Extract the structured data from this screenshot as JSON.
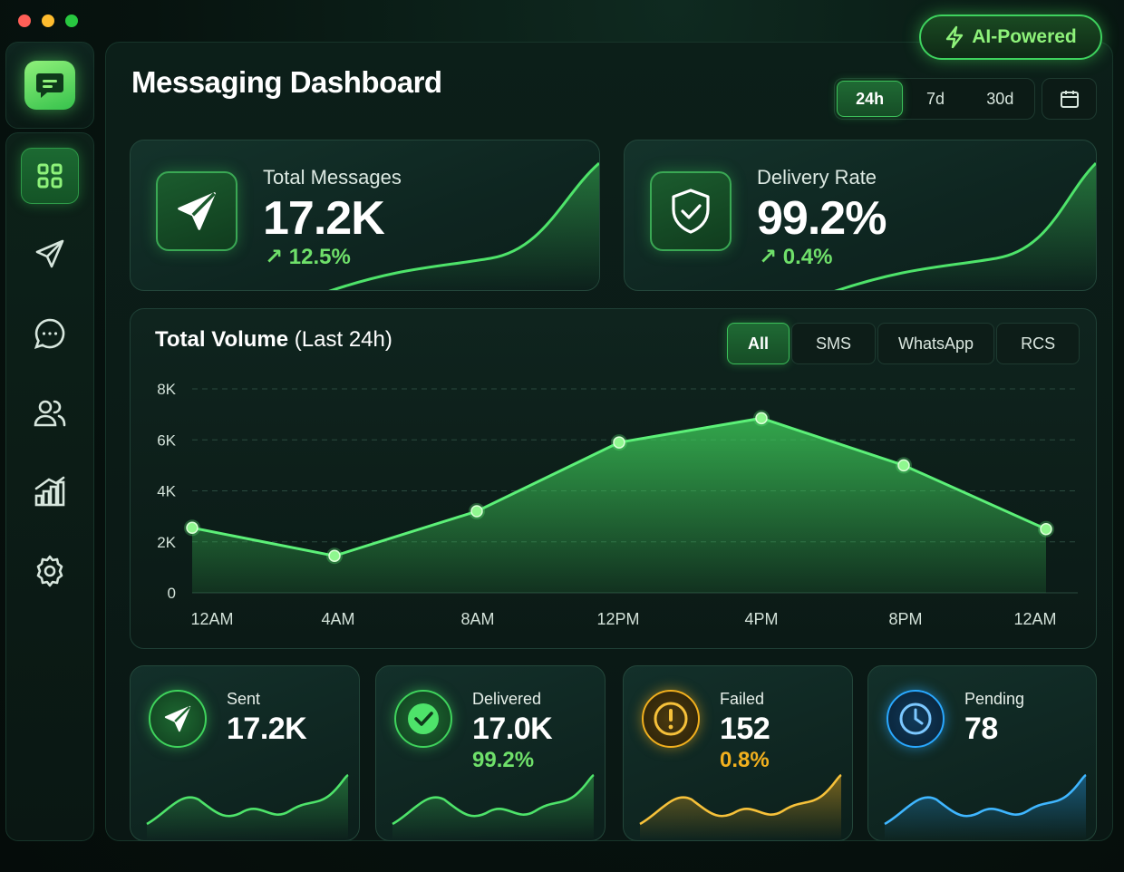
{
  "window": {
    "title": "Messaging Dashboard"
  },
  "badge": {
    "label": "AI-Powered",
    "icon": "lightning-icon"
  },
  "time_range": {
    "options": [
      "24h",
      "7d",
      "30d"
    ],
    "selected": "24h"
  },
  "sidebar": {
    "items": [
      {
        "name": "dashboard",
        "icon": "grid-icon",
        "active": true
      },
      {
        "name": "send",
        "icon": "paper-plane-icon"
      },
      {
        "name": "chats",
        "icon": "chat-bubble-icon"
      },
      {
        "name": "contacts",
        "icon": "users-icon"
      },
      {
        "name": "analytics",
        "icon": "bar-chart-icon"
      },
      {
        "name": "settings",
        "icon": "gear-icon"
      }
    ]
  },
  "kpis": {
    "total_messages": {
      "label": "Total Messages",
      "value": "17.2K",
      "delta": "12.5%",
      "icon": "paper-plane-icon"
    },
    "delivery_rate": {
      "label": "Delivery Rate",
      "value": "99.2%",
      "delta": "0.4%",
      "icon": "shield-check-icon"
    }
  },
  "volume": {
    "title_bold": "Total Volume",
    "title_rest": "(Last 24h)",
    "filters": [
      "All",
      "SMS",
      "WhatsApp",
      "RCS"
    ],
    "selected_filter": "All"
  },
  "chart_data": {
    "type": "area",
    "title": "Total Volume (Last 24h)",
    "x": [
      "12AM",
      "4AM",
      "8AM",
      "12PM",
      "4PM",
      "8PM",
      "12AM"
    ],
    "y_ticks": [
      "8K",
      "6K",
      "4K",
      "2K",
      "0"
    ],
    "ylim": [
      0,
      8000
    ],
    "points": [
      {
        "x": 0,
        "y": 2550
      },
      {
        "x": 4,
        "y": 1450
      },
      {
        "x": 8,
        "y": 3200
      },
      {
        "x": 12,
        "y": 5900
      },
      {
        "x": 16,
        "y": 6850
      },
      {
        "x": 20,
        "y": 5000
      },
      {
        "x": 24,
        "y": 2500
      }
    ],
    "xlim": [
      0,
      24
    ],
    "grid": true,
    "color": "#3fd35c"
  },
  "stats": {
    "sent": {
      "label": "Sent",
      "value": "17.2K",
      "pct": "",
      "color": "#3fd35c",
      "icon": "paper-plane-icon"
    },
    "delivered": {
      "label": "Delivered",
      "value": "17.0K",
      "pct": "99.2%",
      "color": "#3fd35c",
      "icon": "check-circle-icon"
    },
    "failed": {
      "label": "Failed",
      "value": "152",
      "pct": "0.8%",
      "color": "#f2b01e",
      "icon": "alert-circle-icon"
    },
    "pending": {
      "label": "Pending",
      "value": "78",
      "pct": "",
      "color": "#29a8ff",
      "icon": "clock-icon"
    }
  }
}
